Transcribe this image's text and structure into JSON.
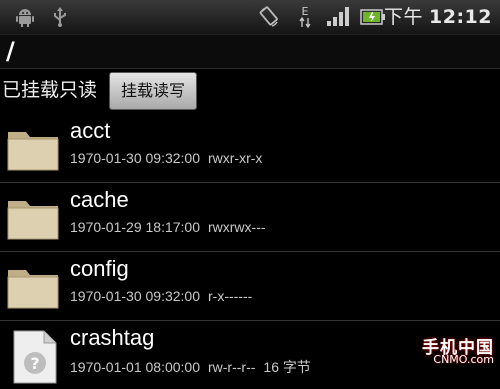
{
  "statusbar": {
    "icons": [
      "android-icon",
      "usb-icon",
      "rotation-icon",
      "data-edge-icon",
      "signal-icon",
      "battery-icon"
    ],
    "ampm": "下午",
    "time": "12:12"
  },
  "path": "/",
  "mount": {
    "status_label": "已挂载只读",
    "button_label": "挂载读写"
  },
  "files": [
    {
      "name": "acct",
      "date": "1970-01-30 09:32:00",
      "perms": "rwxr-xr-x",
      "size": "",
      "type": "folder"
    },
    {
      "name": "cache",
      "date": "1970-01-29 18:17:00",
      "perms": "rwxrwx---",
      "size": "",
      "type": "folder"
    },
    {
      "name": "config",
      "date": "1970-01-30 09:32:00",
      "perms": "r-x------",
      "size": "",
      "type": "folder"
    },
    {
      "name": "crashtag",
      "date": "1970-01-01 08:00:00",
      "perms": "rw-r--r--",
      "size": "16 字节",
      "type": "unknown-file"
    }
  ],
  "watermark": {
    "cn": "手机中国",
    "en": "CNMO.com"
  },
  "colors": {
    "accent": "#6fb52c",
    "folder": "#d9c9a3"
  }
}
